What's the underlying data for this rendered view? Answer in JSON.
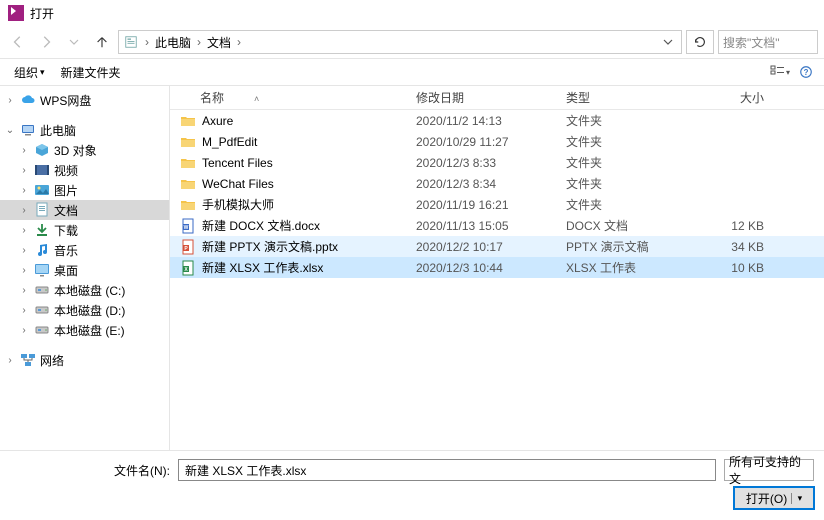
{
  "title": "打开",
  "breadcrumb": {
    "root": "此电脑",
    "current": "文档"
  },
  "search_placeholder": "搜索\"文档\"",
  "toolbar": {
    "organize": "组织",
    "newfolder": "新建文件夹"
  },
  "columns": {
    "name": "名称",
    "modified": "修改日期",
    "type": "类型",
    "size": "大小"
  },
  "sidebar": [
    {
      "icon": "wps-cloud",
      "label": "WPS网盘",
      "exp": ">",
      "indent": 1
    },
    {
      "icon": "pc",
      "label": "此电脑",
      "exp": "v",
      "indent": 1
    },
    {
      "icon": "3d",
      "label": "3D 对象",
      "exp": ">",
      "indent": 2
    },
    {
      "icon": "video",
      "label": "视频",
      "exp": ">",
      "indent": 2
    },
    {
      "icon": "picture",
      "label": "图片",
      "exp": ">",
      "indent": 2
    },
    {
      "icon": "doc",
      "label": "文档",
      "exp": ">",
      "indent": 2,
      "selected": true
    },
    {
      "icon": "download",
      "label": "下载",
      "exp": ">",
      "indent": 2
    },
    {
      "icon": "music",
      "label": "音乐",
      "exp": ">",
      "indent": 2
    },
    {
      "icon": "desktop",
      "label": "桌面",
      "exp": ">",
      "indent": 2
    },
    {
      "icon": "drive",
      "label": "本地磁盘 (C:)",
      "exp": ">",
      "indent": 2
    },
    {
      "icon": "drive",
      "label": "本地磁盘 (D:)",
      "exp": ">",
      "indent": 2
    },
    {
      "icon": "drive",
      "label": "本地磁盘 (E:)",
      "exp": ">",
      "indent": 2
    },
    {
      "icon": "network",
      "label": "网络",
      "exp": ">",
      "indent": 1
    }
  ],
  "files": [
    {
      "icon": "folder",
      "name": "Axure",
      "date": "2020/11/2 14:13",
      "type": "文件夹",
      "size": ""
    },
    {
      "icon": "folder",
      "name": "M_PdfEdit",
      "date": "2020/10/29 11:27",
      "type": "文件夹",
      "size": ""
    },
    {
      "icon": "folder",
      "name": "Tencent Files",
      "date": "2020/12/3 8:33",
      "type": "文件夹",
      "size": ""
    },
    {
      "icon": "folder",
      "name": "WeChat Files",
      "date": "2020/12/3 8:34",
      "type": "文件夹",
      "size": ""
    },
    {
      "icon": "folder",
      "name": "手机模拟大师",
      "date": "2020/11/19 16:21",
      "type": "文件夹",
      "size": ""
    },
    {
      "icon": "docx",
      "name": "新建 DOCX 文档.docx",
      "date": "2020/11/13 15:05",
      "type": "DOCX 文档",
      "size": "12 KB"
    },
    {
      "icon": "pptx",
      "name": "新建 PPTX 演示文稿.pptx",
      "date": "2020/12/2 10:17",
      "type": "PPTX 演示文稿",
      "size": "34 KB",
      "hover": true
    },
    {
      "icon": "xlsx",
      "name": "新建 XLSX 工作表.xlsx",
      "date": "2020/12/3 10:44",
      "type": "XLSX 工作表",
      "size": "10 KB",
      "selected": true
    }
  ],
  "bottom": {
    "filename_label": "文件名(N):",
    "filename_value": "新建 XLSX 工作表.xlsx",
    "filter": "所有可支持的文",
    "open": "打开(O)"
  }
}
